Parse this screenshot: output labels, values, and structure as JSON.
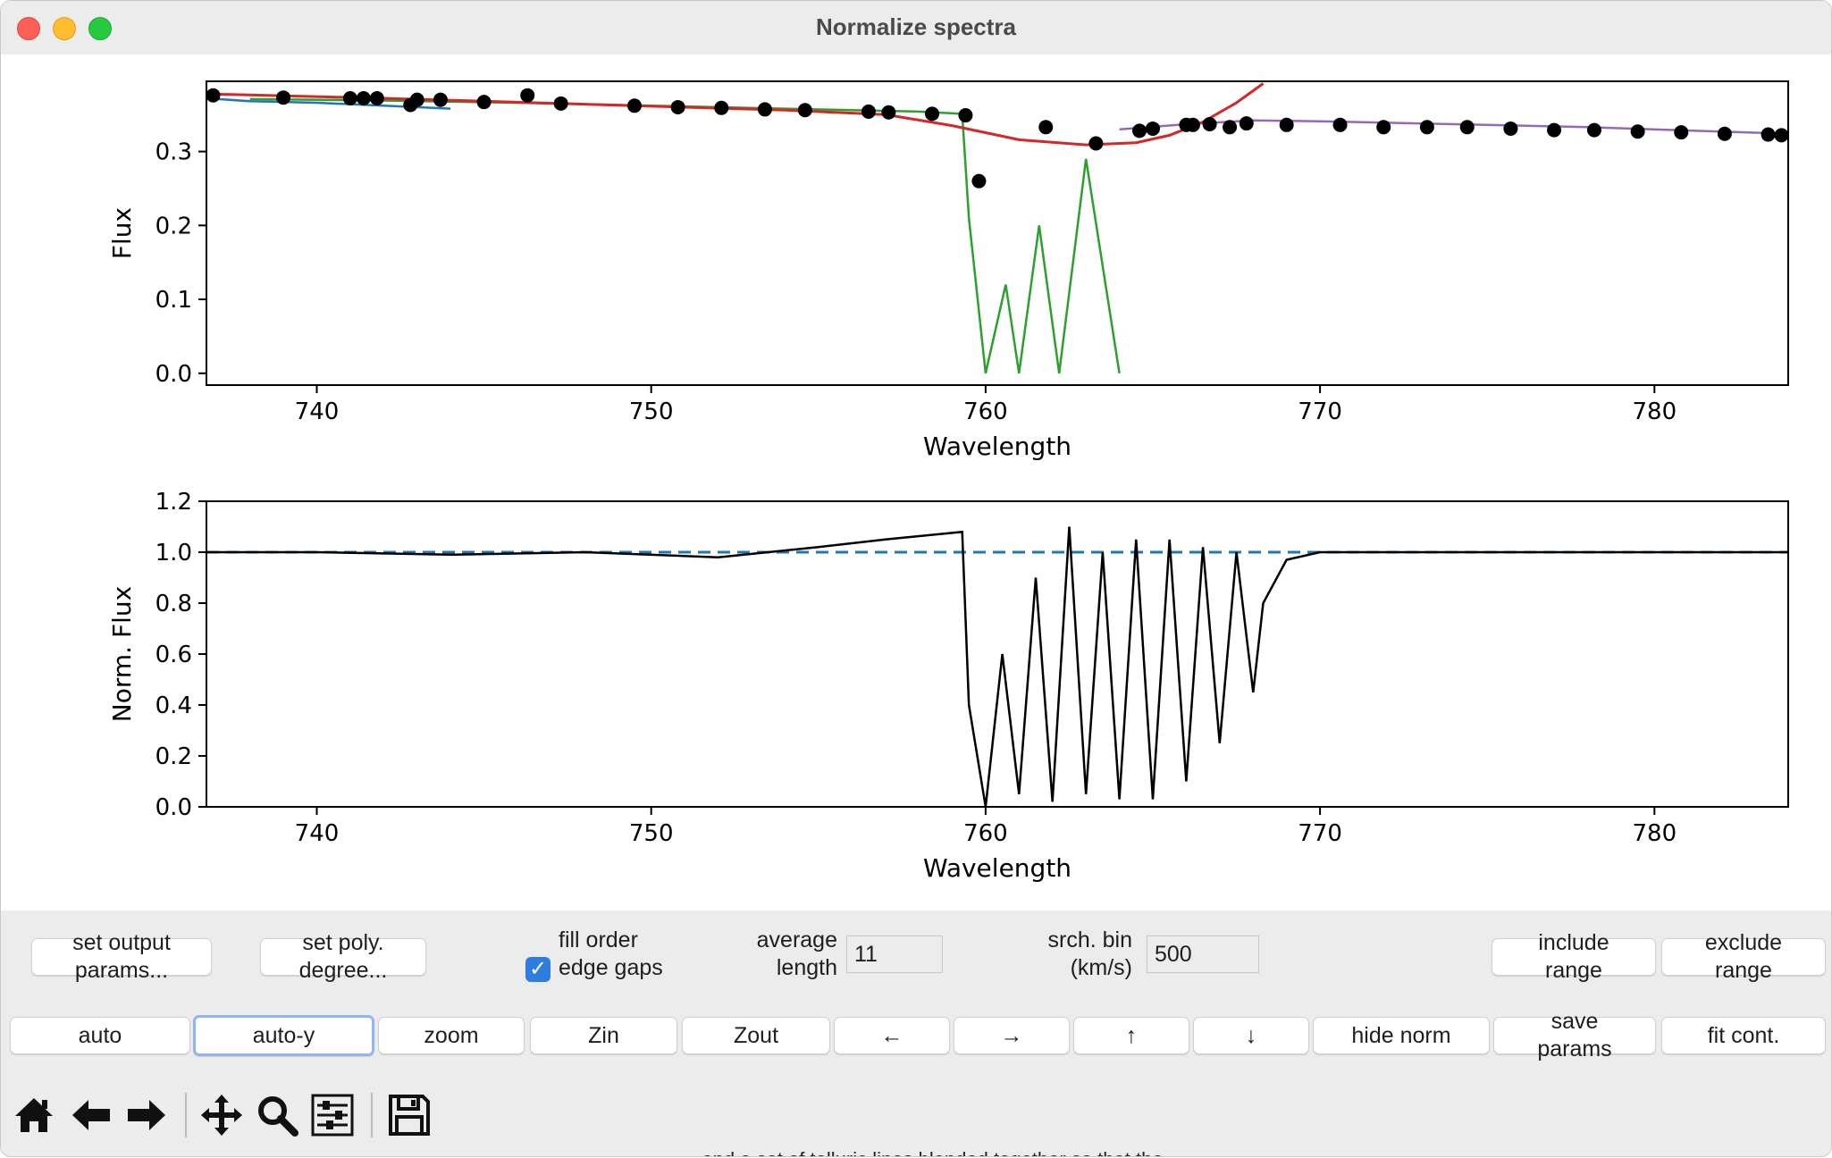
{
  "window": {
    "title": "Normalize spectra"
  },
  "plots": {
    "top": {
      "ylabel": "Flux",
      "xlabel": "Wavelength",
      "xticks": [
        740,
        750,
        760,
        770,
        780
      ],
      "yticks": [
        0.0,
        0.1,
        0.2,
        0.3
      ],
      "yticklabels": [
        "0.0",
        "0.1",
        "0.2",
        "0.3"
      ],
      "xlim": [
        736.7,
        784.0
      ],
      "ylim": [
        -0.016,
        0.395
      ]
    },
    "bottom": {
      "ylabel": "Norm. Flux",
      "xlabel": "Wavelength",
      "xticks": [
        740,
        750,
        760,
        770,
        780
      ],
      "yticks": [
        0.0,
        0.2,
        0.4,
        0.6,
        0.8,
        1.0,
        1.2
      ],
      "yticklabels": [
        "0.0",
        "0.2",
        "0.4",
        "0.6",
        "0.8",
        "1.0",
        "1.2"
      ],
      "xlim": [
        736.7,
        784.0
      ],
      "ylim": [
        0.0,
        1.2
      ]
    }
  },
  "chart_data": [
    {
      "type": "line",
      "ylabel": "Flux",
      "xlabel": "Wavelength",
      "xlim": [
        736.7,
        784.0
      ],
      "ylim": [
        -0.016,
        0.395
      ],
      "series": [
        {
          "kind": "line",
          "color": "#1f77b4",
          "x": [
            736.7,
            738,
            740,
            742,
            744
          ],
          "y": [
            0.372,
            0.368,
            0.366,
            0.362,
            0.358
          ]
        },
        {
          "kind": "line",
          "color": "#2ca02c",
          "x": [
            738,
            742,
            746,
            750,
            754,
            758,
            759.3,
            759.5,
            760,
            760.6,
            761.0,
            761.6,
            762.2,
            763.0,
            764.0
          ],
          "y": [
            0.371,
            0.369,
            0.366,
            0.362,
            0.358,
            0.354,
            0.351,
            0.21,
            0.0,
            0.12,
            0.0,
            0.2,
            0.0,
            0.29,
            0.0
          ]
        },
        {
          "kind": "line",
          "color": "#9467bd",
          "x": [
            764,
            766,
            768,
            770,
            774,
            778,
            782,
            784
          ],
          "y": [
            0.33,
            0.337,
            0.342,
            0.341,
            0.337,
            0.333,
            0.327,
            0.324
          ]
        },
        {
          "kind": "line",
          "color": "#d62728",
          "x": [
            736.7,
            742,
            748,
            754,
            757,
            759,
            761,
            763,
            764.5,
            765.5,
            766.5,
            767.5,
            768.3
          ],
          "y": [
            0.378,
            0.372,
            0.364,
            0.356,
            0.35,
            0.335,
            0.316,
            0.309,
            0.312,
            0.322,
            0.34,
            0.366,
            0.392
          ]
        },
        {
          "kind": "scatter",
          "color": "#000000",
          "x": [
            736.9,
            739.0,
            741.0,
            741.4,
            741.8,
            742.8,
            743.0,
            743.7,
            745.0,
            746.3,
            747.3,
            749.5,
            750.8,
            752.1,
            753.4,
            754.6,
            756.5,
            757.1,
            758.4,
            759.4,
            759.8,
            761.8,
            763.3,
            764.6,
            765.0,
            766.0,
            766.2,
            766.7,
            767.3,
            767.8,
            769.0,
            770.6,
            771.9,
            773.2,
            774.4,
            775.7,
            777.0,
            778.2,
            779.5,
            780.8,
            782.1,
            783.4,
            783.8
          ],
          "y": [
            0.376,
            0.373,
            0.372,
            0.372,
            0.372,
            0.363,
            0.37,
            0.37,
            0.367,
            0.376,
            0.365,
            0.362,
            0.36,
            0.359,
            0.357,
            0.356,
            0.354,
            0.353,
            0.351,
            0.349,
            0.26,
            0.333,
            0.311,
            0.328,
            0.331,
            0.336,
            0.336,
            0.337,
            0.333,
            0.338,
            0.336,
            0.336,
            0.333,
            0.333,
            0.333,
            0.331,
            0.329,
            0.329,
            0.327,
            0.326,
            0.324,
            0.323,
            0.322
          ]
        }
      ]
    },
    {
      "type": "line",
      "ylabel": "Norm. Flux",
      "xlabel": "Wavelength",
      "xlim": [
        736.7,
        784.0
      ],
      "ylim": [
        0.0,
        1.2
      ],
      "series": [
        {
          "kind": "dashed",
          "color": "#1f77b4",
          "x": [
            736.7,
            784.0
          ],
          "y": [
            1.0,
            1.0
          ]
        },
        {
          "kind": "line",
          "color": "#000000",
          "x": [
            736.7,
            740,
            744,
            748,
            752,
            755,
            757,
            759.3,
            759.5,
            760.0,
            760.5,
            761.0,
            761.5,
            762.0,
            762.5,
            763.0,
            763.5,
            764.0,
            764.5,
            765.0,
            765.5,
            766.0,
            766.5,
            767.0,
            767.5,
            768.0,
            768.3,
            769.0,
            770.0,
            775.0,
            780.0,
            784.0
          ],
          "y": [
            1.0,
            1.0,
            0.99,
            1.0,
            0.98,
            1.02,
            1.05,
            1.08,
            0.4,
            0.0,
            0.6,
            0.05,
            0.9,
            0.02,
            1.1,
            0.05,
            1.0,
            0.03,
            1.05,
            0.03,
            1.05,
            0.1,
            1.02,
            0.25,
            1.0,
            0.45,
            0.8,
            0.97,
            1.0,
            1.0,
            1.0,
            1.0
          ]
        }
      ]
    }
  ],
  "controls": {
    "set_output_params": "set output\nparams...",
    "set_poly_degree": "set poly.\ndegree...",
    "fill_order_edge_gaps": "fill order\nedge gaps",
    "fill_order_checked": true,
    "average_length_label": "average\nlength",
    "average_length_value": "11",
    "srch_bin_label": "srch. bin\n(km/s)",
    "srch_bin_value": "500",
    "include_range": "include\nrange",
    "exclude_range": "exclude\nrange"
  },
  "buttons": {
    "auto": "auto",
    "auto_y": "auto-y",
    "zoom": "zoom",
    "zin": "Zin",
    "zout": "Zout",
    "left": "←",
    "right": "→",
    "up": "↑",
    "down": "↓",
    "hide_norm": "hide norm",
    "save_params": "save\nparams",
    "fit_cont": "fit cont."
  },
  "toolbar": {
    "icons": [
      "home-icon",
      "back-arrow-icon",
      "forward-arrow-icon",
      "pan-icon",
      "zoom-magnifier-icon",
      "configure-subplots-icon",
      "save-icon"
    ]
  },
  "background_text": "... and a set of telluric lines blended together so that the ..."
}
